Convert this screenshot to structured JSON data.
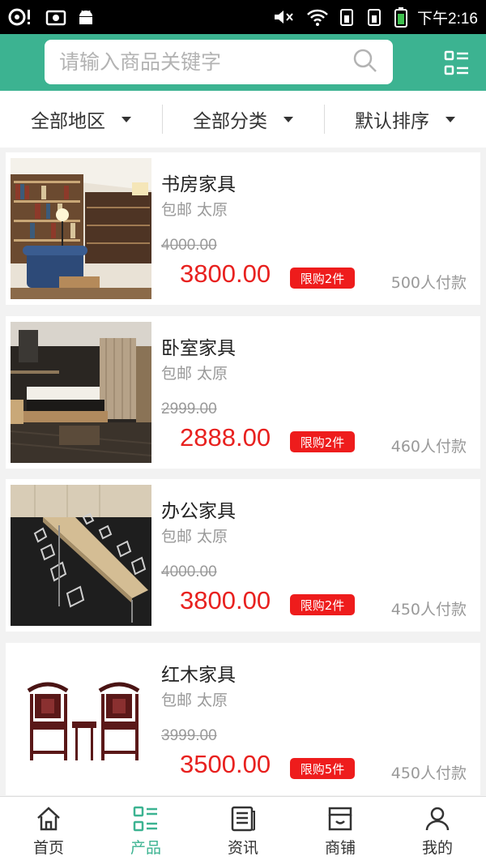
{
  "status_bar": {
    "time": "下午2:16"
  },
  "search": {
    "placeholder": "请输入商品关键字"
  },
  "filters": [
    {
      "label": "全部地区"
    },
    {
      "label": "全部分类"
    },
    {
      "label": "默认排序"
    }
  ],
  "products": [
    {
      "title": "书房家具",
      "meta": "包邮 太原",
      "old_price": "4000.00",
      "price": "3800.00",
      "limit": "限购2件",
      "sold": "500人付款",
      "image": "study-room-furniture"
    },
    {
      "title": "卧室家具",
      "meta": "包邮 太原",
      "old_price": "2999.00",
      "price": "2888.00",
      "limit": "限购2件",
      "sold": "460人付款",
      "image": "bedroom-furniture"
    },
    {
      "title": "办公家具",
      "meta": "包邮 太原",
      "old_price": "4000.00",
      "price": "3800.00",
      "limit": "限购2件",
      "sold": "450人付款",
      "image": "office-furniture"
    },
    {
      "title": "红木家具",
      "meta": "包邮 太原",
      "old_price": "3999.00",
      "price": "3500.00",
      "limit": "限购5件",
      "sold": "450人付款",
      "image": "rosewood-furniture"
    }
  ],
  "bottom_nav": [
    {
      "label": "首页",
      "icon": "home-icon"
    },
    {
      "label": "产品",
      "icon": "products-icon",
      "active": true
    },
    {
      "label": "资讯",
      "icon": "news-icon"
    },
    {
      "label": "商铺",
      "icon": "store-icon"
    },
    {
      "label": "我的",
      "icon": "profile-icon"
    }
  ],
  "colors": {
    "brand": "#3cb391",
    "price": "#e8211f",
    "limit_badge": "#ee1c1c"
  }
}
